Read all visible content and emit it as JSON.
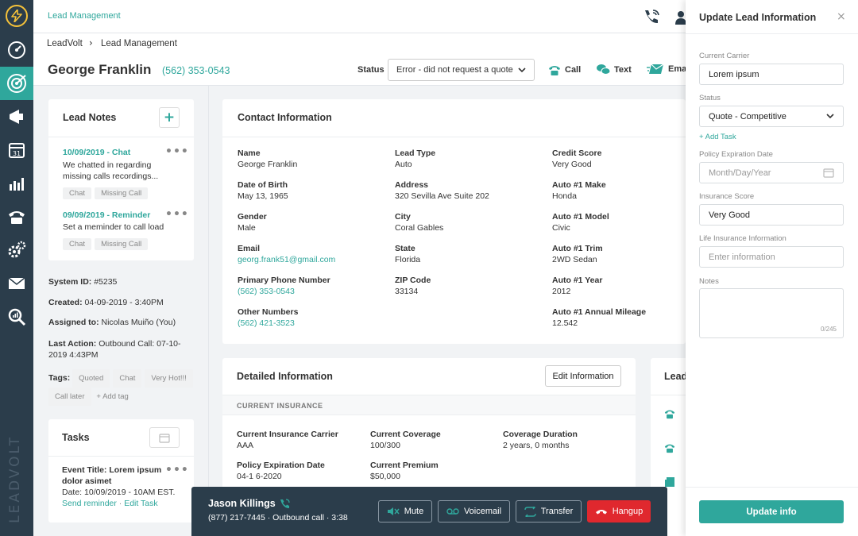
{
  "topbar": {
    "title": "Lead Management"
  },
  "breadcrumb": {
    "root": "LeadVolt",
    "current": "Lead Management"
  },
  "lead": {
    "name": "George Franklin",
    "phone": "(562) 353-0543"
  },
  "status": {
    "label": "Status",
    "value": "Error - did not request a quote"
  },
  "actions": {
    "call": "Call",
    "text": "Text",
    "email": "Ema"
  },
  "notes": {
    "title": "Lead Notes",
    "items": [
      {
        "date": "10/09/2019 - Chat",
        "text": "We chatted in regarding missing calls recordings...",
        "tags": [
          "Chat",
          "Missing Call"
        ]
      },
      {
        "date": "09/09/2019 - Reminder",
        "text": "Set a meminder to call load",
        "tags": [
          "Chat",
          "Missing Call"
        ]
      }
    ]
  },
  "meta": {
    "system_id_label": "System ID:",
    "system_id": "#5235",
    "created_label": "Created:",
    "created": "04-09-2019 - 3:40PM",
    "assigned_label": "Assigned to:",
    "assigned": "Nicolas Muiño (You)",
    "last_action_label": "Last Action:",
    "last_action": "Outbound Call: 07-10-2019 4:43PM",
    "tags_label": "Tags:",
    "tags": [
      "Quoted",
      "Chat",
      "Very Hot!!!",
      "Call later"
    ],
    "add_tag": "+ Add tag"
  },
  "tasks": {
    "title": "Tasks",
    "item": {
      "title": "Event Title: Lorem ipsum dolor asimet",
      "date": "Date: 10/09/2019 - 10AM EST.",
      "send": "Send reminder",
      "edit": "Edit Task"
    }
  },
  "contact": {
    "title": "Contact Information",
    "col1": [
      {
        "label": "Name",
        "value": "George Franklin"
      },
      {
        "label": "Date of Birth",
        "value": "May 13, 1965"
      },
      {
        "label": "Gender",
        "value": "Male"
      },
      {
        "label": "Email",
        "value": "georg.frank51@gmail.com"
      },
      {
        "label": "Primary Phone Number",
        "value": "(562) 353-0543"
      },
      {
        "label": "Other Numbers",
        "value": "(562) 421-3523"
      }
    ],
    "col2": [
      {
        "label": "Lead Type",
        "value": "Auto"
      },
      {
        "label": "Address",
        "value": "320 Sevilla Ave Suite 202"
      },
      {
        "label": "City",
        "value": "Coral Gables"
      },
      {
        "label": "State",
        "value": "Florida"
      },
      {
        "label": "ZIP Code",
        "value": "33134"
      }
    ],
    "col3": [
      {
        "label": "Credit Score",
        "value": "Very Good"
      },
      {
        "label": "Auto #1 Make",
        "value": "Honda"
      },
      {
        "label": "Auto #1 Model",
        "value": "Civic"
      },
      {
        "label": "Auto #1 Trim",
        "value": "2WD Sedan"
      },
      {
        "label": "Auto #1 Year",
        "value": "2012"
      },
      {
        "label": "Auto #1 Annual Mileage",
        "value": "12.542"
      }
    ]
  },
  "detailed": {
    "title": "Detailed Information",
    "edit_button": "Edit Information",
    "section": "CURRENT INSURANCE",
    "fields": [
      {
        "label": "Current Insurance Carrier",
        "value": "AAA"
      },
      {
        "label": "Current Coverage",
        "value": "100/300"
      },
      {
        "label": "Coverage Duration",
        "value": "2 years, 0 months"
      },
      {
        "label": "Policy Expiration Date",
        "value": "04-1 6-2020"
      },
      {
        "label": "Current Premium",
        "value": "$50,000"
      }
    ]
  },
  "leads_card": {
    "title": "Lead"
  },
  "call": {
    "name": "Jason Killings",
    "phone": "(877) 217-7445",
    "type": "Outbound call",
    "duration": "3:38",
    "mute": "Mute",
    "voicemail": "Voicemail",
    "transfer": "Transfer",
    "hangup": "Hangup"
  },
  "panel": {
    "title": "Update Lead Information",
    "carrier_label": "Current Carrier",
    "carrier_value": "Lorem ipsum",
    "status_label": "Status",
    "status_value": "Quote - Competitive",
    "add_task": "+ Add Task",
    "policy_label": "Policy Expiration Date",
    "policy_placeholder": "Month/Day/Year",
    "score_label": "Insurance Score",
    "score_value": "Very Good",
    "life_label": "Life Insurance Information",
    "life_placeholder": "Enter information",
    "notes_label": "Notes",
    "notes_counter": "0/245",
    "submit": "Update info"
  },
  "brand": {
    "vertical_logo": "LEADVOLT"
  },
  "colors": {
    "accent": "#2fa79c",
    "sidebar": "#2b3d4b",
    "hangup": "#e0282e",
    "logo": "#f5c23a"
  }
}
